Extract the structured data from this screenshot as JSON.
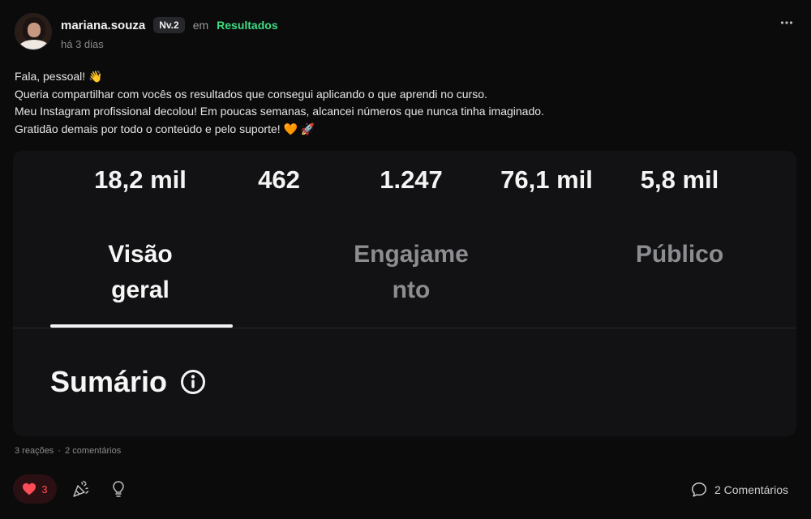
{
  "author": {
    "username": "mariana.souza",
    "level_badge": "Nv.2",
    "preposition": "em",
    "category": "Resultados",
    "posted_time": "há 3 dias"
  },
  "post": {
    "lines": [
      "Fala, pessoal! 👋",
      "Queria compartilhar com vocês os resultados que consegui aplicando o que aprendi no curso.",
      "Meu Instagram profissional decolou! Em poucas semanas, alcancei números que nunca tinha imaginado.",
      "Gratidão demais por todo o conteúdo e pelo suporte! 🧡 🚀"
    ]
  },
  "embed": {
    "stats": [
      "18,2 mil",
      "462",
      "1.247",
      "76,1 mil",
      "5,8 mil"
    ],
    "tabs": [
      {
        "line1": "Visão",
        "line2": "geral",
        "active": true
      },
      {
        "line1": "Engajame",
        "line2": "nto",
        "active": false
      },
      {
        "line1": "Público",
        "line2": "",
        "active": false
      }
    ],
    "summary_title": "Sumário"
  },
  "footer": {
    "reactions_text": "3 reações",
    "separator": "·",
    "comments_text": "2 comentários",
    "like_count": "3",
    "comments_button_label": "2 Comentários"
  },
  "colors": {
    "background": "#0b0b0c",
    "accent_green": "#3ddc84",
    "like_red": "#ff4d57",
    "embed_bg": "#121214"
  },
  "icons": [
    "more-options-icon",
    "info-icon",
    "heart-icon",
    "party-popper-icon",
    "lightbulb-icon",
    "comment-bubble-icon"
  ]
}
